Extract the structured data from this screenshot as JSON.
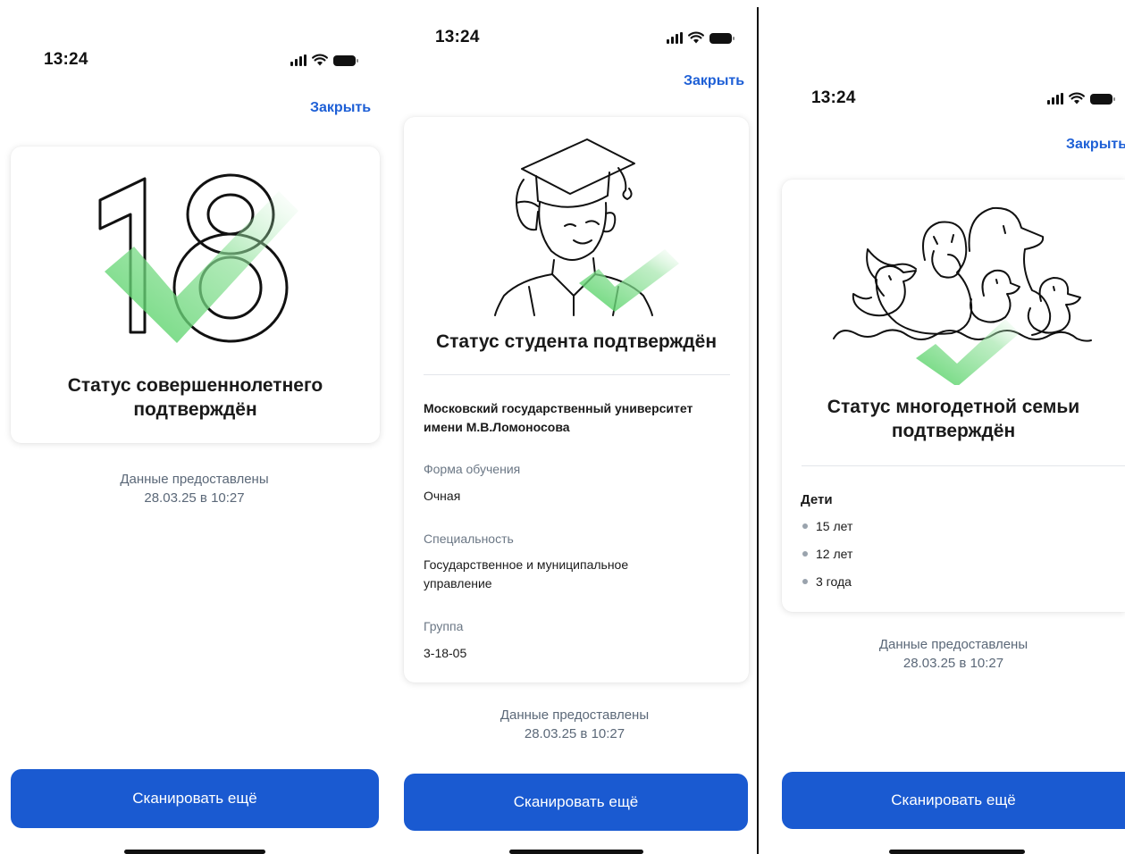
{
  "colors": {
    "accent": "#1a5ad1",
    "link": "#1d5fd6",
    "check_green": "#5fd36e"
  },
  "screens": [
    {
      "status_bar": {
        "time": "13:24"
      },
      "close_label": "Закрыть",
      "illustration": "number-18-with-checkmark",
      "title_lines": [
        "Статус совершеннолетнего",
        "подтверждён"
      ],
      "meta_lines": [
        "Данные предоставлены",
        "28.03.25 в 10:27"
      ],
      "scan_button_label": "Сканировать ещё"
    },
    {
      "status_bar": {
        "time": "13:24"
      },
      "close_label": "Закрыть",
      "illustration": "student-with-graduation-cap-and-checkmark",
      "title": "Статус студента подтверждён",
      "university_lines": [
        "Московский государственный университет",
        "имени М.В.Ломоносова"
      ],
      "fields": [
        {
          "label": "Форма обучения",
          "value_lines": [
            "Очная"
          ]
        },
        {
          "label": "Специальность",
          "value_lines": [
            "Государственное и муниципальное",
            "управление"
          ]
        },
        {
          "label": "Группа",
          "value_lines": [
            "3-18-05"
          ]
        }
      ],
      "meta_lines": [
        "Данные предоставлены",
        "28.03.25 в 10:27"
      ],
      "scan_button_label": "Сканировать ещё"
    },
    {
      "status_bar": {
        "time": "13:24"
      },
      "close_label": "Закрыть",
      "illustration": "duck-family-with-checkmark",
      "title_lines": [
        "Статус многодетной семьи",
        "подтверждён"
      ],
      "children_title": "Дети",
      "children": [
        "15 лет",
        "12 лет",
        "3 года"
      ],
      "meta_lines": [
        "Данные предоставлены",
        "28.03.25 в 10:27"
      ],
      "scan_button_label": "Сканировать ещё"
    }
  ]
}
